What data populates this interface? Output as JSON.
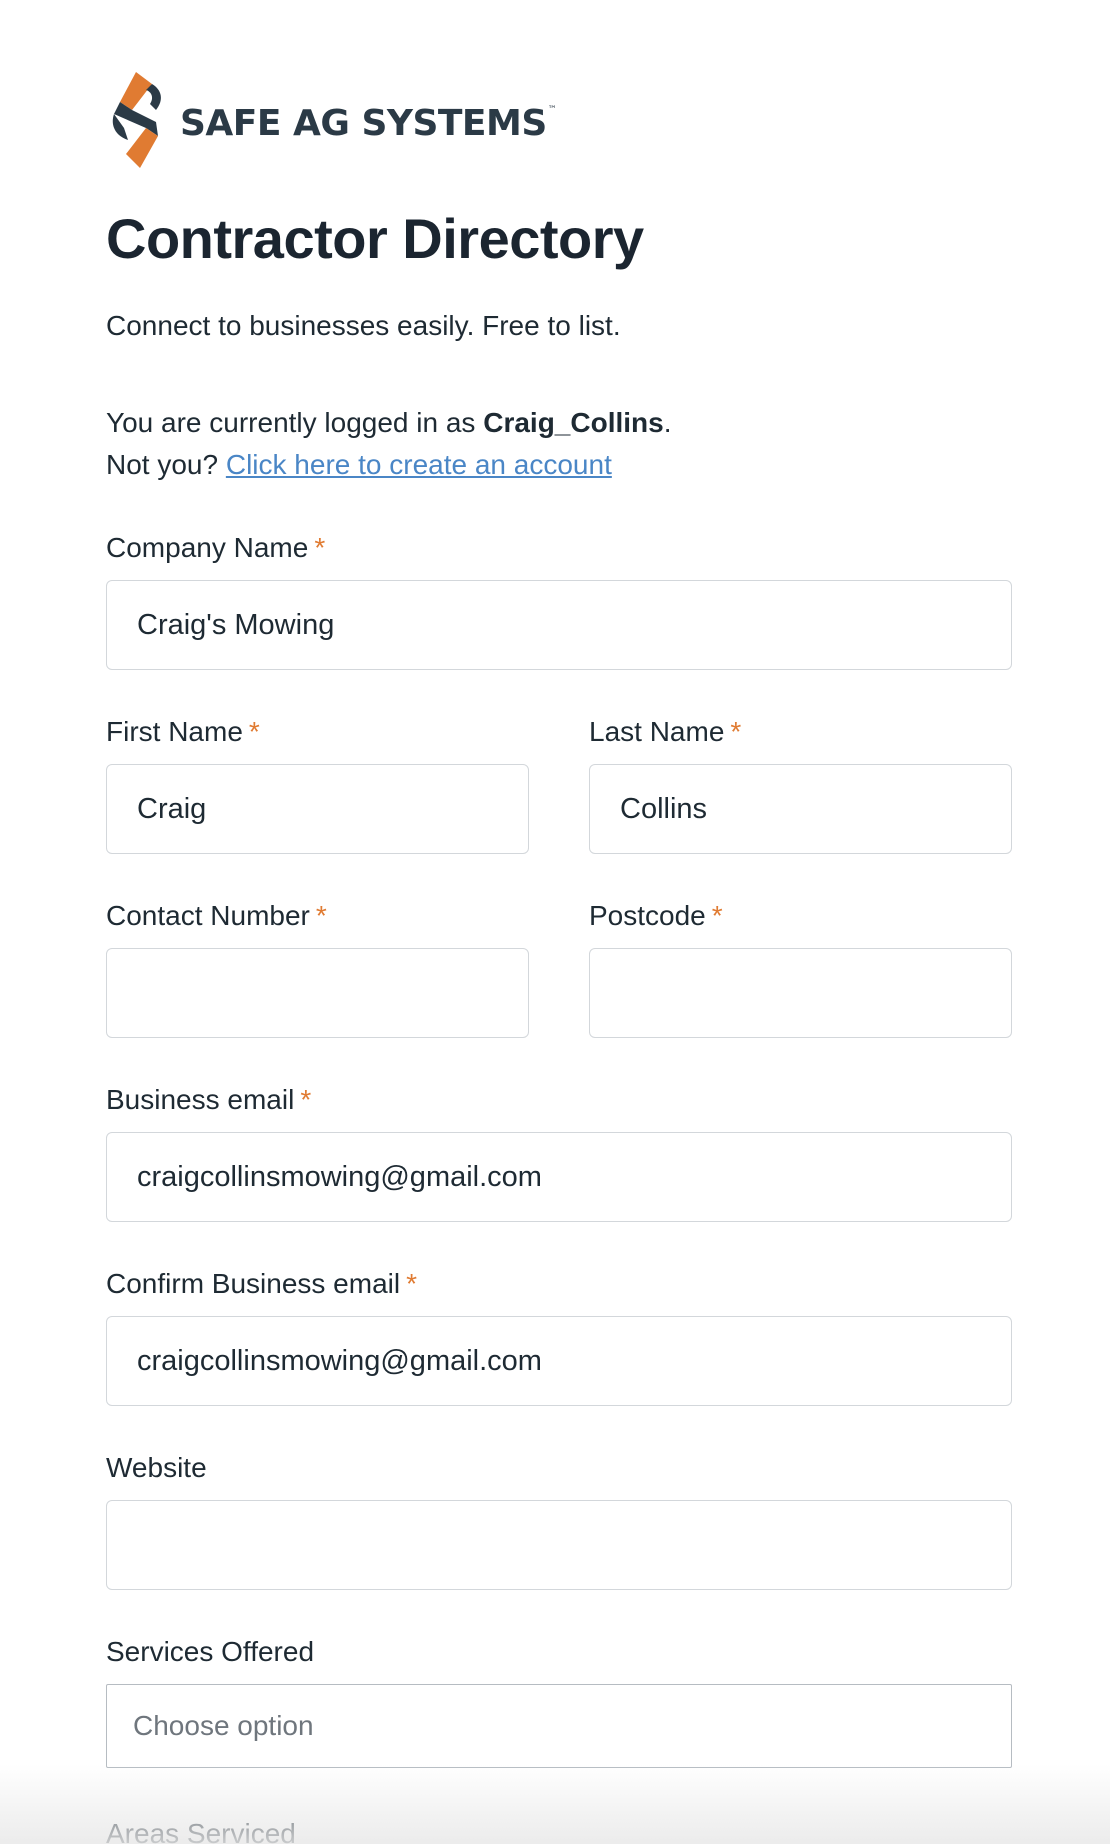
{
  "brand": {
    "name": "SAFE AG SYSTEMS",
    "trademark": "™",
    "colors": {
      "dark": "#2b3a46",
      "orange": "#e07b32"
    }
  },
  "header": {
    "title": "Contractor Directory",
    "subtitle": "Connect to businesses easily. Free to list."
  },
  "login": {
    "prefix": "You are currently logged in as ",
    "username": "Craig_Collins",
    "suffix": ".",
    "not_you": "Not you? ",
    "create_link": "Click here to create an account"
  },
  "form": {
    "required_marker": "*",
    "company_name": {
      "label": "Company Name",
      "value": "Craig's Mowing"
    },
    "first_name": {
      "label": "First Name",
      "value": "Craig"
    },
    "last_name": {
      "label": "Last Name",
      "value": "Collins"
    },
    "contact_number": {
      "label": "Contact Number",
      "value": ""
    },
    "postcode": {
      "label": "Postcode",
      "value": ""
    },
    "business_email": {
      "label": "Business email",
      "value": "craigcollinsmowing@gmail.com"
    },
    "confirm_business_email": {
      "label": "Confirm Business email",
      "value": "craigcollinsmowing@gmail.com"
    },
    "website": {
      "label": "Website",
      "value": ""
    },
    "services_offered": {
      "label": "Services Offered",
      "placeholder": "Choose option"
    },
    "areas_serviced": {
      "label": "Areas Serviced"
    }
  },
  "colors": {
    "link": "#4a86c6",
    "required": "#e07b32",
    "text": "#1e2a33",
    "input_border": "#d3d7db"
  }
}
